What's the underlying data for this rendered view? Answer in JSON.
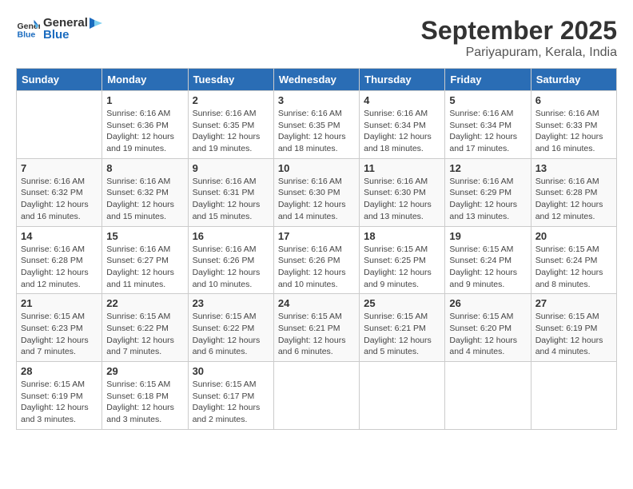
{
  "logo": {
    "line1": "General",
    "line2": "Blue"
  },
  "title": "September 2025",
  "location": "Pariyapuram, Kerala, India",
  "weekdays": [
    "Sunday",
    "Monday",
    "Tuesday",
    "Wednesday",
    "Thursday",
    "Friday",
    "Saturday"
  ],
  "weeks": [
    [
      {
        "day": "",
        "detail": ""
      },
      {
        "day": "1",
        "detail": "Sunrise: 6:16 AM\nSunset: 6:36 PM\nDaylight: 12 hours\nand 19 minutes."
      },
      {
        "day": "2",
        "detail": "Sunrise: 6:16 AM\nSunset: 6:35 PM\nDaylight: 12 hours\nand 19 minutes."
      },
      {
        "day": "3",
        "detail": "Sunrise: 6:16 AM\nSunset: 6:35 PM\nDaylight: 12 hours\nand 18 minutes."
      },
      {
        "day": "4",
        "detail": "Sunrise: 6:16 AM\nSunset: 6:34 PM\nDaylight: 12 hours\nand 18 minutes."
      },
      {
        "day": "5",
        "detail": "Sunrise: 6:16 AM\nSunset: 6:34 PM\nDaylight: 12 hours\nand 17 minutes."
      },
      {
        "day": "6",
        "detail": "Sunrise: 6:16 AM\nSunset: 6:33 PM\nDaylight: 12 hours\nand 16 minutes."
      }
    ],
    [
      {
        "day": "7",
        "detail": "Sunrise: 6:16 AM\nSunset: 6:32 PM\nDaylight: 12 hours\nand 16 minutes."
      },
      {
        "day": "8",
        "detail": "Sunrise: 6:16 AM\nSunset: 6:32 PM\nDaylight: 12 hours\nand 15 minutes."
      },
      {
        "day": "9",
        "detail": "Sunrise: 6:16 AM\nSunset: 6:31 PM\nDaylight: 12 hours\nand 15 minutes."
      },
      {
        "day": "10",
        "detail": "Sunrise: 6:16 AM\nSunset: 6:30 PM\nDaylight: 12 hours\nand 14 minutes."
      },
      {
        "day": "11",
        "detail": "Sunrise: 6:16 AM\nSunset: 6:30 PM\nDaylight: 12 hours\nand 13 minutes."
      },
      {
        "day": "12",
        "detail": "Sunrise: 6:16 AM\nSunset: 6:29 PM\nDaylight: 12 hours\nand 13 minutes."
      },
      {
        "day": "13",
        "detail": "Sunrise: 6:16 AM\nSunset: 6:28 PM\nDaylight: 12 hours\nand 12 minutes."
      }
    ],
    [
      {
        "day": "14",
        "detail": "Sunrise: 6:16 AM\nSunset: 6:28 PM\nDaylight: 12 hours\nand 12 minutes."
      },
      {
        "day": "15",
        "detail": "Sunrise: 6:16 AM\nSunset: 6:27 PM\nDaylight: 12 hours\nand 11 minutes."
      },
      {
        "day": "16",
        "detail": "Sunrise: 6:16 AM\nSunset: 6:26 PM\nDaylight: 12 hours\nand 10 minutes."
      },
      {
        "day": "17",
        "detail": "Sunrise: 6:16 AM\nSunset: 6:26 PM\nDaylight: 12 hours\nand 10 minutes."
      },
      {
        "day": "18",
        "detail": "Sunrise: 6:15 AM\nSunset: 6:25 PM\nDaylight: 12 hours\nand 9 minutes."
      },
      {
        "day": "19",
        "detail": "Sunrise: 6:15 AM\nSunset: 6:24 PM\nDaylight: 12 hours\nand 9 minutes."
      },
      {
        "day": "20",
        "detail": "Sunrise: 6:15 AM\nSunset: 6:24 PM\nDaylight: 12 hours\nand 8 minutes."
      }
    ],
    [
      {
        "day": "21",
        "detail": "Sunrise: 6:15 AM\nSunset: 6:23 PM\nDaylight: 12 hours\nand 7 minutes."
      },
      {
        "day": "22",
        "detail": "Sunrise: 6:15 AM\nSunset: 6:22 PM\nDaylight: 12 hours\nand 7 minutes."
      },
      {
        "day": "23",
        "detail": "Sunrise: 6:15 AM\nSunset: 6:22 PM\nDaylight: 12 hours\nand 6 minutes."
      },
      {
        "day": "24",
        "detail": "Sunrise: 6:15 AM\nSunset: 6:21 PM\nDaylight: 12 hours\nand 6 minutes."
      },
      {
        "day": "25",
        "detail": "Sunrise: 6:15 AM\nSunset: 6:21 PM\nDaylight: 12 hours\nand 5 minutes."
      },
      {
        "day": "26",
        "detail": "Sunrise: 6:15 AM\nSunset: 6:20 PM\nDaylight: 12 hours\nand 4 minutes."
      },
      {
        "day": "27",
        "detail": "Sunrise: 6:15 AM\nSunset: 6:19 PM\nDaylight: 12 hours\nand 4 minutes."
      }
    ],
    [
      {
        "day": "28",
        "detail": "Sunrise: 6:15 AM\nSunset: 6:19 PM\nDaylight: 12 hours\nand 3 minutes."
      },
      {
        "day": "29",
        "detail": "Sunrise: 6:15 AM\nSunset: 6:18 PM\nDaylight: 12 hours\nand 3 minutes."
      },
      {
        "day": "30",
        "detail": "Sunrise: 6:15 AM\nSunset: 6:17 PM\nDaylight: 12 hours\nand 2 minutes."
      },
      {
        "day": "",
        "detail": ""
      },
      {
        "day": "",
        "detail": ""
      },
      {
        "day": "",
        "detail": ""
      },
      {
        "day": "",
        "detail": ""
      }
    ]
  ]
}
